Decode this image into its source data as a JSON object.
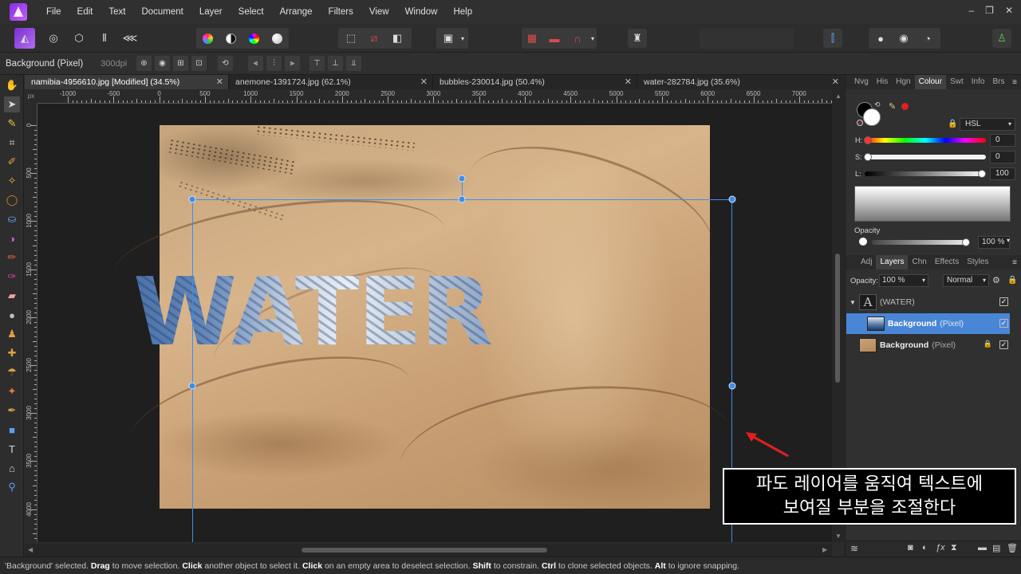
{
  "app": {
    "name": "Affinity Photo"
  },
  "menu": [
    "File",
    "Edit",
    "Text",
    "Document",
    "Layer",
    "Select",
    "Arrange",
    "Filters",
    "View",
    "Window",
    "Help"
  ],
  "window_controls": {
    "minimize": "–",
    "restore": "❐",
    "close": "✕"
  },
  "context": {
    "layer": "Background (Pixel)",
    "dpi": "300dpi"
  },
  "tabs": [
    {
      "label": "namibia-4956610.jpg [Modified] (34.5%)",
      "active": true
    },
    {
      "label": "anemone-1391724.jpg (62.1%)",
      "active": false
    },
    {
      "label": "bubbles-230014.jpg (50.4%)",
      "active": false
    },
    {
      "label": "water-282784.jpg (35.6%)",
      "active": false
    }
  ],
  "tab_close": "✕",
  "ruler": {
    "unit": "px",
    "h_labels": [
      "-1000",
      "-500",
      "0",
      "500",
      "1000",
      "1500",
      "2000",
      "2500",
      "3000",
      "3500",
      "4000",
      "4500",
      "5000",
      "5500",
      "6000",
      "6500",
      "7000"
    ],
    "v_labels": [
      "0",
      "500",
      "1000",
      "1500",
      "2000",
      "2500",
      "3000",
      "3500",
      "4000"
    ]
  },
  "canvas": {
    "text_layer_content": "WATER"
  },
  "callout": {
    "line1": "파도 레이어를 움직여 텍스트에",
    "line2": "보여질 부분을 조절한다"
  },
  "colour_panel": {
    "tabs": [
      "Nvg",
      "His",
      "Hgn",
      "Colour",
      "Swt",
      "Info",
      "Brs"
    ],
    "active_tab": "Colour",
    "model": "HSL",
    "h_label": "H:",
    "h_value": "0",
    "s_label": "S:",
    "s_value": "0",
    "l_label": "L:",
    "l_value": "100",
    "opacity_label": "Opacity",
    "opacity_value": "100 %"
  },
  "layers_panel": {
    "tabs": [
      "Adj",
      "Layers",
      "Chn",
      "Effects",
      "Styles"
    ],
    "active_tab": "Layers",
    "opacity_label": "Opacity:",
    "opacity_value": "100 %",
    "blend_mode": "Normal",
    "layers": [
      {
        "name": "(WATER)",
        "type": "",
        "selected": false
      },
      {
        "name": "Background",
        "type": "(Pixel)",
        "selected": true
      },
      {
        "name": "Background",
        "type": "(Pixel)",
        "selected": false
      }
    ]
  },
  "status": {
    "p1": "'Background' selected. ",
    "b1": "Drag",
    "p2": " to move selection. ",
    "b2": "Click",
    "p3": " another object to select it. ",
    "b3": "Click",
    "p4": " on an empty area to deselect selection. ",
    "b4": "Shift",
    "p5": " to constrain. ",
    "b5": "Ctrl",
    "p6": " to clone selected objects. ",
    "b6": "Alt",
    "p7": " to ignore snapping."
  },
  "colors": {
    "accent": "#3d8ee8",
    "selected_layer": "#4a86d6",
    "arrow": "#e02020"
  }
}
